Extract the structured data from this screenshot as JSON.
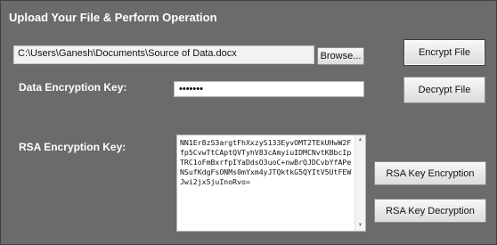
{
  "window": {
    "title": "Upload Your File & Perform Operation"
  },
  "file": {
    "path": "C:\\Users\\Ganesh\\Documents\\Source of Data.docx",
    "browse_label": "Browse..."
  },
  "buttons": {
    "encrypt_label": "Encrypt File",
    "decrypt_label": "Decrypt File",
    "rsa_encrypt_label": "RSA Key Encryption",
    "rsa_decrypt_label": "RSA Key Decryption"
  },
  "data_key": {
    "label": "Data Encryption Key:",
    "value": "•••••••"
  },
  "rsa": {
    "label": "RSA Encryption Key:",
    "value": "NN1Er8zS3argtFhXxzyS133EyvOMT2TEkUHwW2Ffp5CvwTtCAptQVTyhV83cAmyiuIDMCNvtKBbcIpTRC1oFmBxrfpIYaDdsO3uoC+nwBrQJDCvbYfAPeNSufKdgFsONMs0mYxm4yJTQktkG5QYItV5UtFEWJwi2jx5juInoRvo="
  },
  "icons": {
    "scroll_up": "scroll-up-icon",
    "scroll_down": "scroll-down-icon"
  },
  "colors": {
    "background": "#6b6b6b",
    "label_text": "#ffffff"
  }
}
